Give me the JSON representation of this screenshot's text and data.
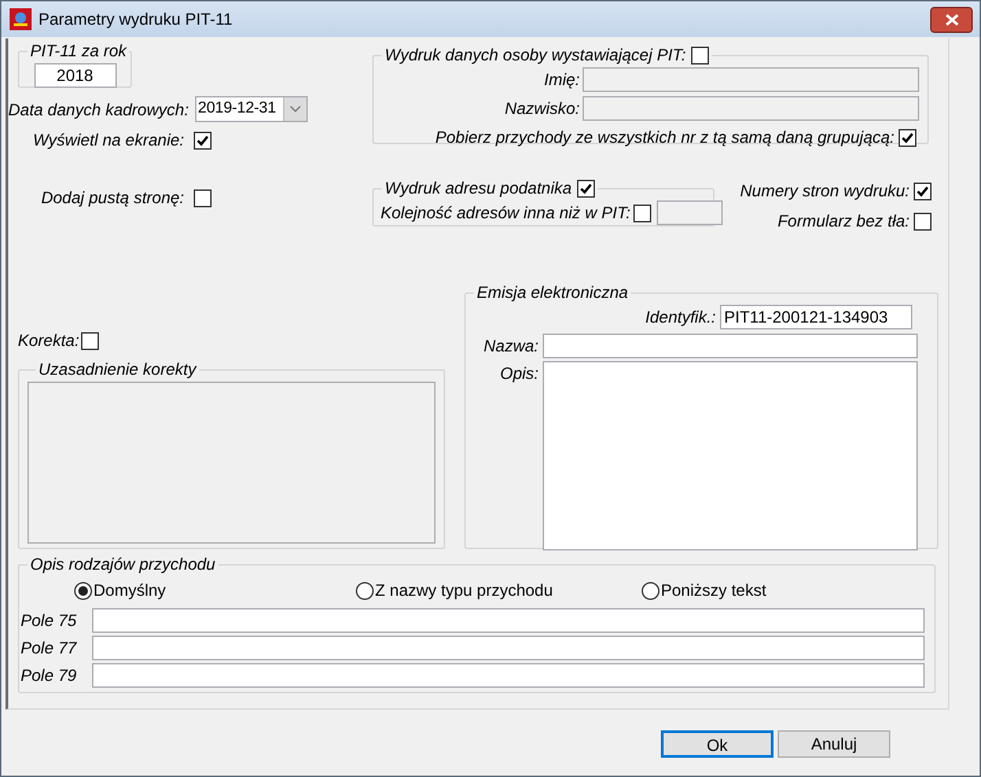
{
  "window": {
    "title": "Parametry wydruku PIT-11"
  },
  "year_group": {
    "title": "PIT-11 za rok",
    "value": "2018"
  },
  "hr_date": {
    "label": "Data danych kadrowych:",
    "value": "2019-12-31"
  },
  "show_on_screen": {
    "label": "Wyświetl na ekranie:",
    "checked": true
  },
  "add_blank_page": {
    "label": "Dodaj pustą stronę:",
    "checked": false
  },
  "issuer_group": {
    "title": "Wydruk danych osoby wystawiającej PIT:",
    "checked": false,
    "fields": [
      {
        "label": "Imię:",
        "disabled": true
      },
      {
        "label": "Nazwisko:",
        "disabled": true
      }
    ],
    "fetch_income": {
      "label": "Pobierz przychody ze wszystkich nr z tą samą daną grupującą:",
      "checked": true
    }
  },
  "address_group": {
    "title": "Wydruk adresu podatnika",
    "checked": true,
    "order": {
      "label": "Kolejność adresów inna niż w PIT:",
      "checked": false,
      "field_disabled": true
    }
  },
  "page_numbers": {
    "label": "Numery stron wydruku:",
    "checked": true
  },
  "no_background": {
    "label": "Formularz bez tła:",
    "checked": false
  },
  "correction": {
    "label": "Korekta:",
    "checked": false
  },
  "correction_reason": {
    "title": "Uzasadnienie korekty",
    "disabled": true
  },
  "e_emission": {
    "title": "Emisja elektroniczna",
    "fields": [
      {
        "kind": "short",
        "label": "Identyfik.:",
        "value": "PIT11-200121-134903"
      },
      {
        "kind": "line",
        "label": "Nazwa:"
      },
      {
        "kind": "area",
        "label": "Opis:"
      }
    ]
  },
  "income_description": {
    "title": "Opis rodzajów przychodu",
    "options": [
      {
        "label": "Domyślny",
        "selected": true
      },
      {
        "label": "Z nazwy typu przychodu",
        "selected": false
      },
      {
        "label": "Poniższy tekst",
        "selected": false
      }
    ],
    "fields": [
      {
        "label": "Pole 75"
      },
      {
        "label": "Pole 77"
      },
      {
        "label": "Pole 79"
      }
    ]
  },
  "buttons": [
    {
      "label": "Ok",
      "default": true
    },
    {
      "label": "Anuluj",
      "default": false
    }
  ]
}
